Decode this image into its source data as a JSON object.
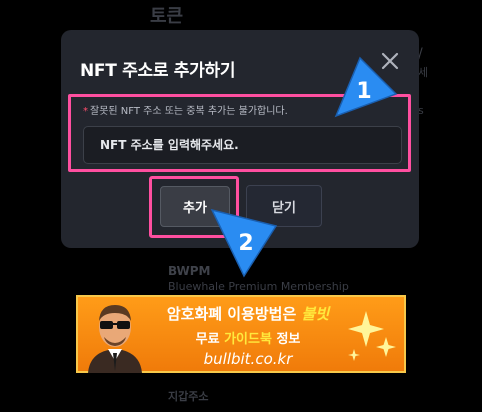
{
  "background": {
    "page_title": "토큰",
    "side_a": "/",
    "side_b": "세",
    "side_c": "s",
    "membership_name": "BWPM",
    "membership_sub": "Bluewhale Premium Membership",
    "wallet_label": "지갑주소"
  },
  "modal": {
    "title": "NFT 주소로 추가하기",
    "close_icon": "close-icon",
    "warning_star": "*",
    "warning_text": "잘못된 NFT 주소 또는 중복 추가는 불가합니다.",
    "input_placeholder": "NFT 주소를 입력해주세요.",
    "input_value": "",
    "add_label": "추가",
    "close_label": "닫기"
  },
  "markers": {
    "one": "1",
    "two": "2"
  },
  "banner": {
    "line1_prefix": "암호화폐 이용방법은",
    "line1_highlight": "불빗",
    "line2_prefix": "무료",
    "line2_highlight": "가이드북",
    "line2_suffix": "정보",
    "domain": "bullbit.co.kr"
  },
  "colors": {
    "highlight_border": "#ff4fa0",
    "marker_blue": "#2a8cf2",
    "banner_orange": "#f7880f"
  }
}
